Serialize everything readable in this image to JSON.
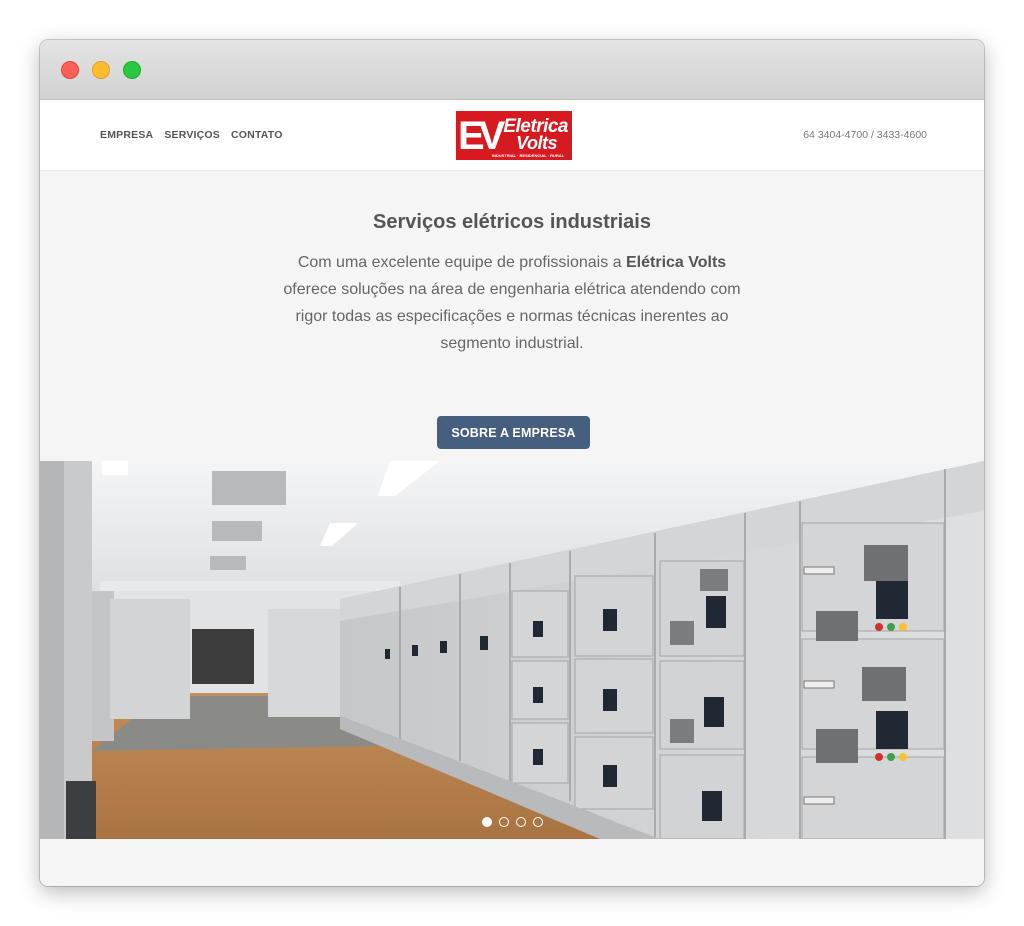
{
  "window": {
    "controls": [
      "close",
      "minimize",
      "maximize"
    ]
  },
  "nav": {
    "links": [
      "EMPRESA",
      "SERVIÇOS",
      "CONTATO"
    ],
    "phone": "64 3404-4700 / 3433-4600"
  },
  "logo": {
    "mark": "EV",
    "line1": "Eletrica",
    "line2": "Volts",
    "tagline": "INDUSTRIAL · RESIDENCIAL · RURAL",
    "color": "#d71920"
  },
  "hero": {
    "title": "Serviços elétricos industriais",
    "desc_before": "Com uma excelente equipe de profissionais a ",
    "desc_brand": "Elétrica Volts",
    "desc_after": " oferece soluções na área de engenharia elétrica atendendo com rigor todas as especificações e normas técnicas inerentes ao segmento industrial.",
    "button": "SOBRE A EMPRESA",
    "button_color": "#475f7f"
  },
  "carousel": {
    "slide_count": 4,
    "active_index": 0
  }
}
